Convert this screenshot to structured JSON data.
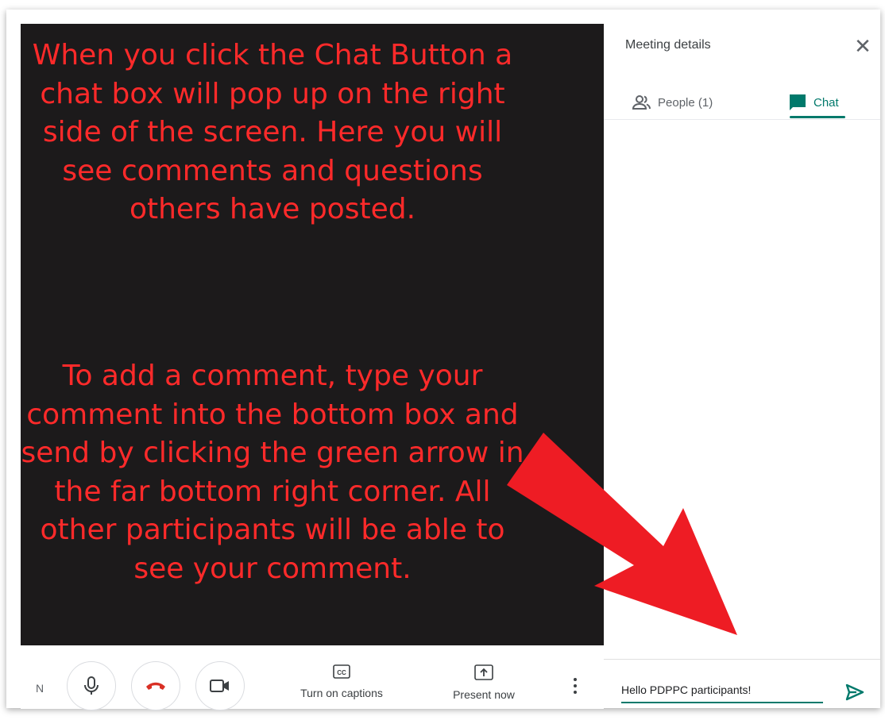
{
  "video": {
    "instructions_1": "When you click the Chat Button a chat box will pop up on the right side of the screen.  Here you will see comments and questions others have posted.",
    "instructions_2": "To add a comment, type your comment into the bottom box and send by clicking the green arrow in the far bottom right corner.  All other participants will be able to see your comment."
  },
  "side_panel": {
    "title": "Meeting details",
    "close_icon": "close-icon",
    "tabs": [
      {
        "label": "People (1)",
        "icon": "people-icon",
        "active": false
      },
      {
        "label": "Chat",
        "icon": "chat-icon",
        "active": true
      }
    ],
    "compose": {
      "value": "Hello PDPPC participants!"
    },
    "send_icon": "send-icon"
  },
  "controls": {
    "clipped_text": "N",
    "mic_icon": "mic-icon",
    "hangup_icon": "hangup-icon",
    "camera_icon": "camera-icon",
    "captions_label": "Turn on captions",
    "present_label": "Present now",
    "more_icon": "more-vert-icon"
  },
  "colors": {
    "accent": "#00796b",
    "annotation_red": "#ff2a2a",
    "arrow_red": "#ee1c24",
    "video_bg": "#1c1a1b",
    "hangup": "#d93025"
  }
}
